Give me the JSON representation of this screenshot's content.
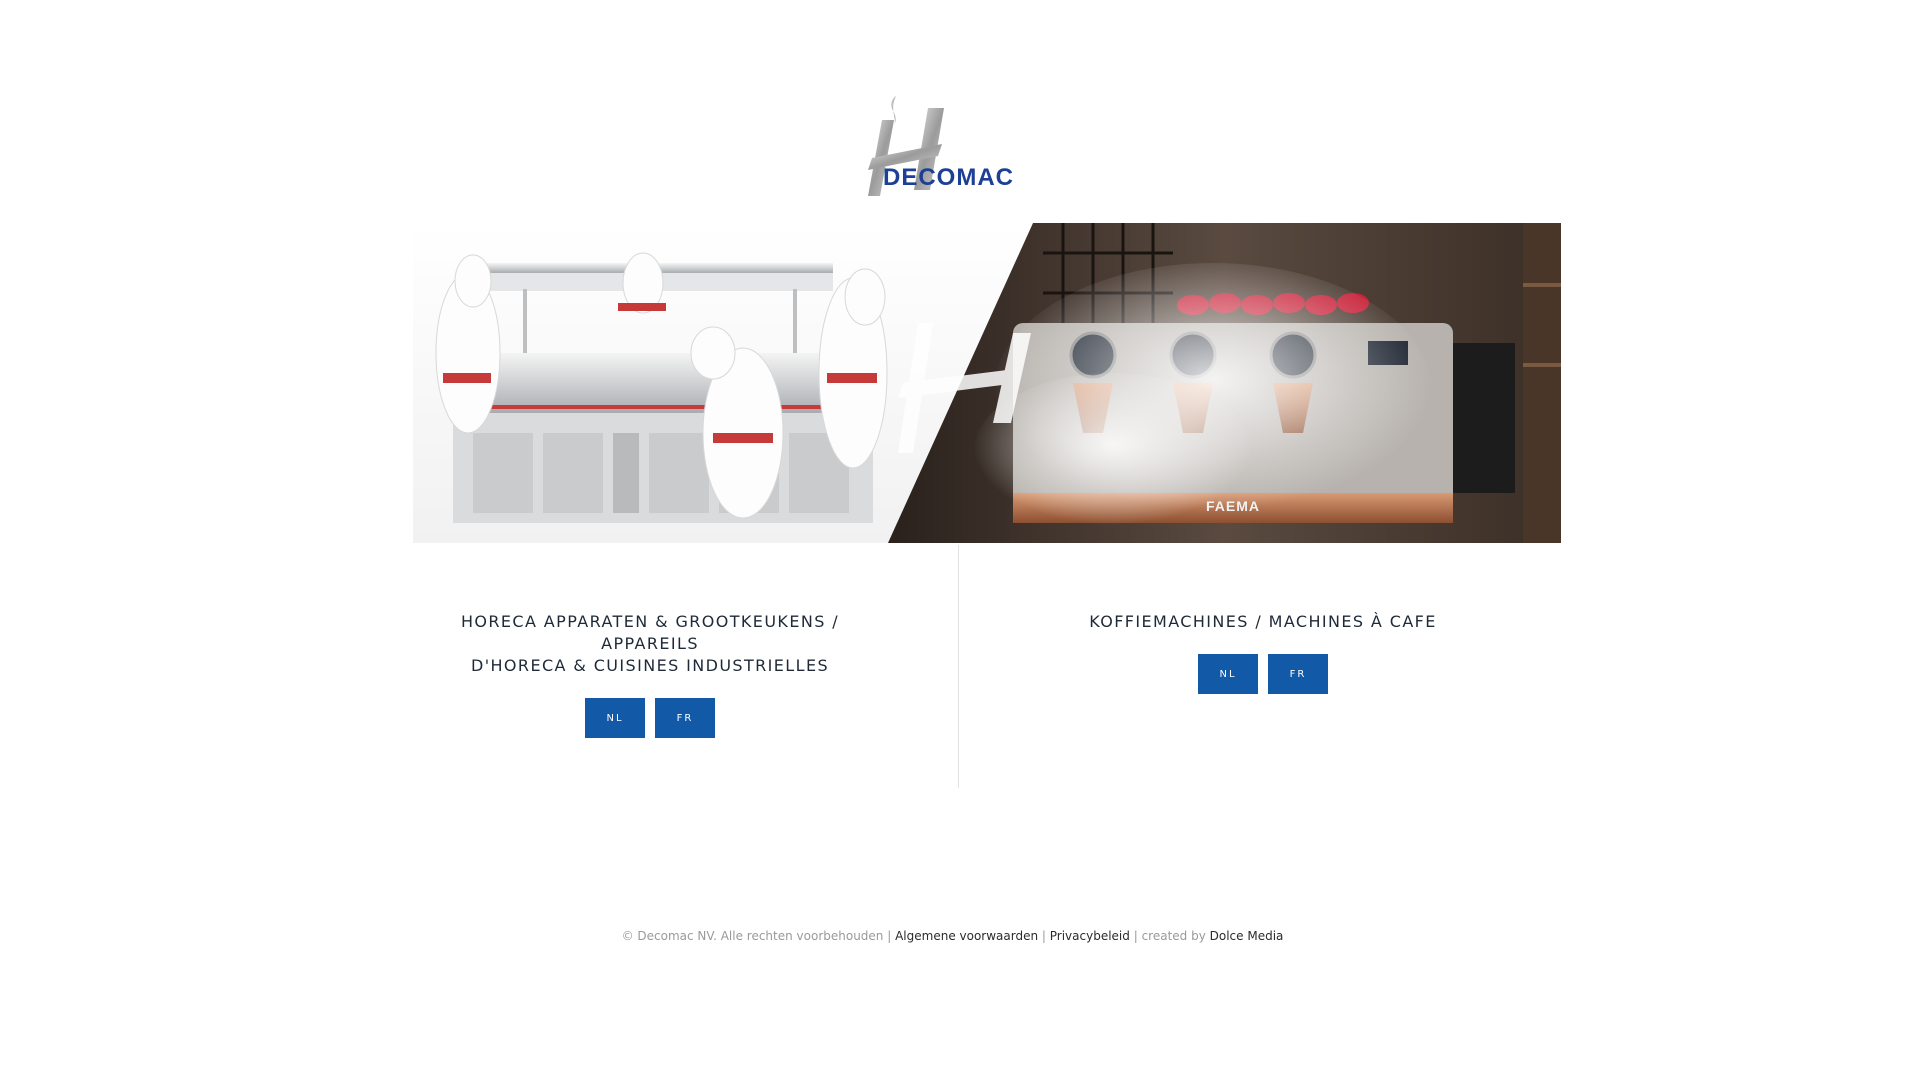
{
  "logo": {
    "text": "DECOMAC",
    "brand_color": "#1d3f95"
  },
  "hero": {
    "icon_left": "chef-kitchen-image",
    "icon_right": "espresso-machine-image",
    "machine_brand": "FAEMA"
  },
  "columns": [
    {
      "title_line1": "HORECA APPARATEN & GROOTKEUKENS / APPAREILS",
      "title_line2": "D'HORECA & CUISINES INDUSTRIELLES",
      "buttons": [
        "NL",
        "FR"
      ]
    },
    {
      "title_line1": "KOFFIEMACHINES / MACHINES À CAFE",
      "buttons": [
        "NL",
        "FR"
      ]
    }
  ],
  "footer": {
    "copyright": "© Decomac NV. Alle rechten voorbehouden",
    "sep1": " | ",
    "terms": "Algemene voorwaarden",
    "sep2": " | ",
    "privacy": "Privacybeleid",
    "sep3": " | created by ",
    "creator": "Dolce Media"
  },
  "colors": {
    "button": "#1259a8",
    "text": "#1f2a38",
    "footer_text": "#9a9a9a"
  }
}
